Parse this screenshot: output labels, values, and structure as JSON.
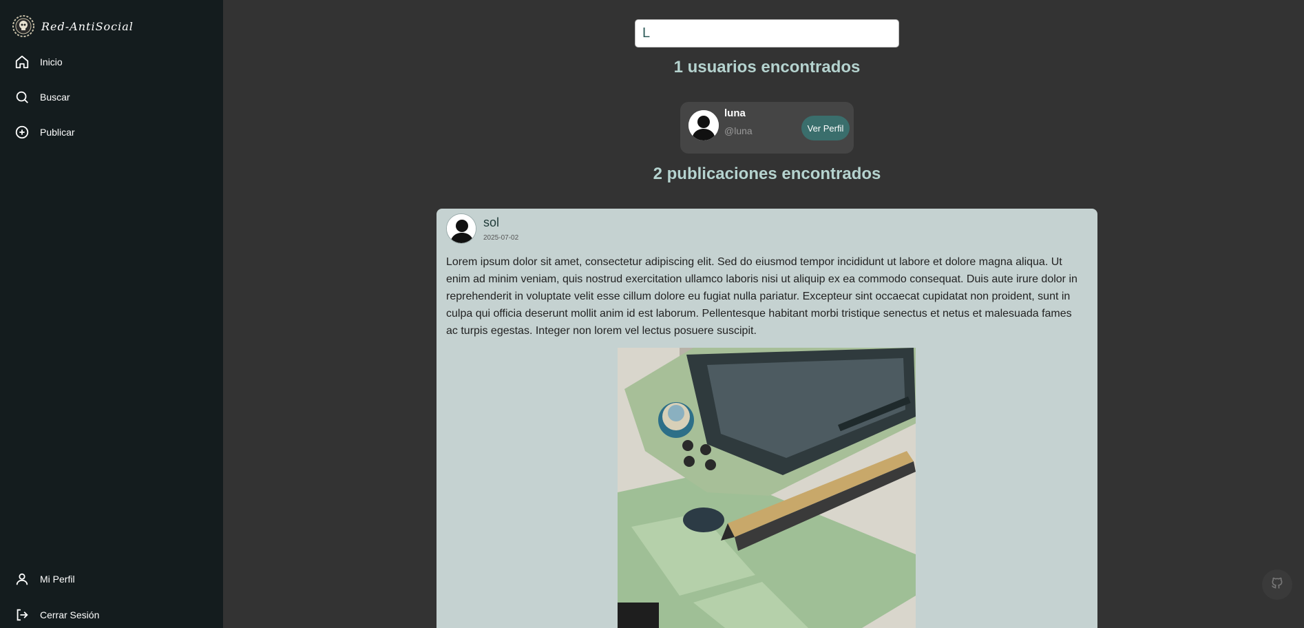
{
  "brand": {
    "name": "Red-AntiSocial",
    "logo_icon": "skull-logo-icon"
  },
  "sidebar": {
    "items": [
      {
        "label": "Inicio",
        "icon": "home-icon"
      },
      {
        "label": "Buscar",
        "icon": "search-icon"
      },
      {
        "label": "Publicar",
        "icon": "plus-circle-icon"
      }
    ],
    "bottom_items": [
      {
        "label": "Mi Perfil",
        "icon": "user-icon"
      },
      {
        "label": "Cerrar Sesión",
        "icon": "logout-icon"
      }
    ]
  },
  "search": {
    "value": "L"
  },
  "users_result": {
    "heading": "1 usuarios encontrados",
    "users": [
      {
        "name": "luna",
        "handle": "@luna",
        "button_label": "Ver Perfil"
      }
    ]
  },
  "posts_result": {
    "heading": "2 publicaciones encontrados",
    "posts": [
      {
        "author": "sol",
        "date": "2025-07-02",
        "body": "Lorem ipsum dolor sit amet, consectetur adipiscing elit. Sed do eiusmod tempor incididunt ut labore et dolore magna aliqua. Ut enim ad minim veniam, quis nostrud exercitation ullamco laboris nisi ut aliquip ex ea commodo consequat. Duis aute irure dolor in reprehenderit in voluptate velit esse cillum dolore eu fugiat nulla pariatur. Excepteur sint occaecat cupidatat non proident, sunt in culpa qui officia deserunt mollit anim id est laborum. Pellentesque habitant morbi tristique senectus et netus et malesuada fames ac turpis egestas. Integer non lorem vel lectus posuere suscipit."
      }
    ]
  },
  "floating_button": {
    "icon": "github-icon"
  }
}
